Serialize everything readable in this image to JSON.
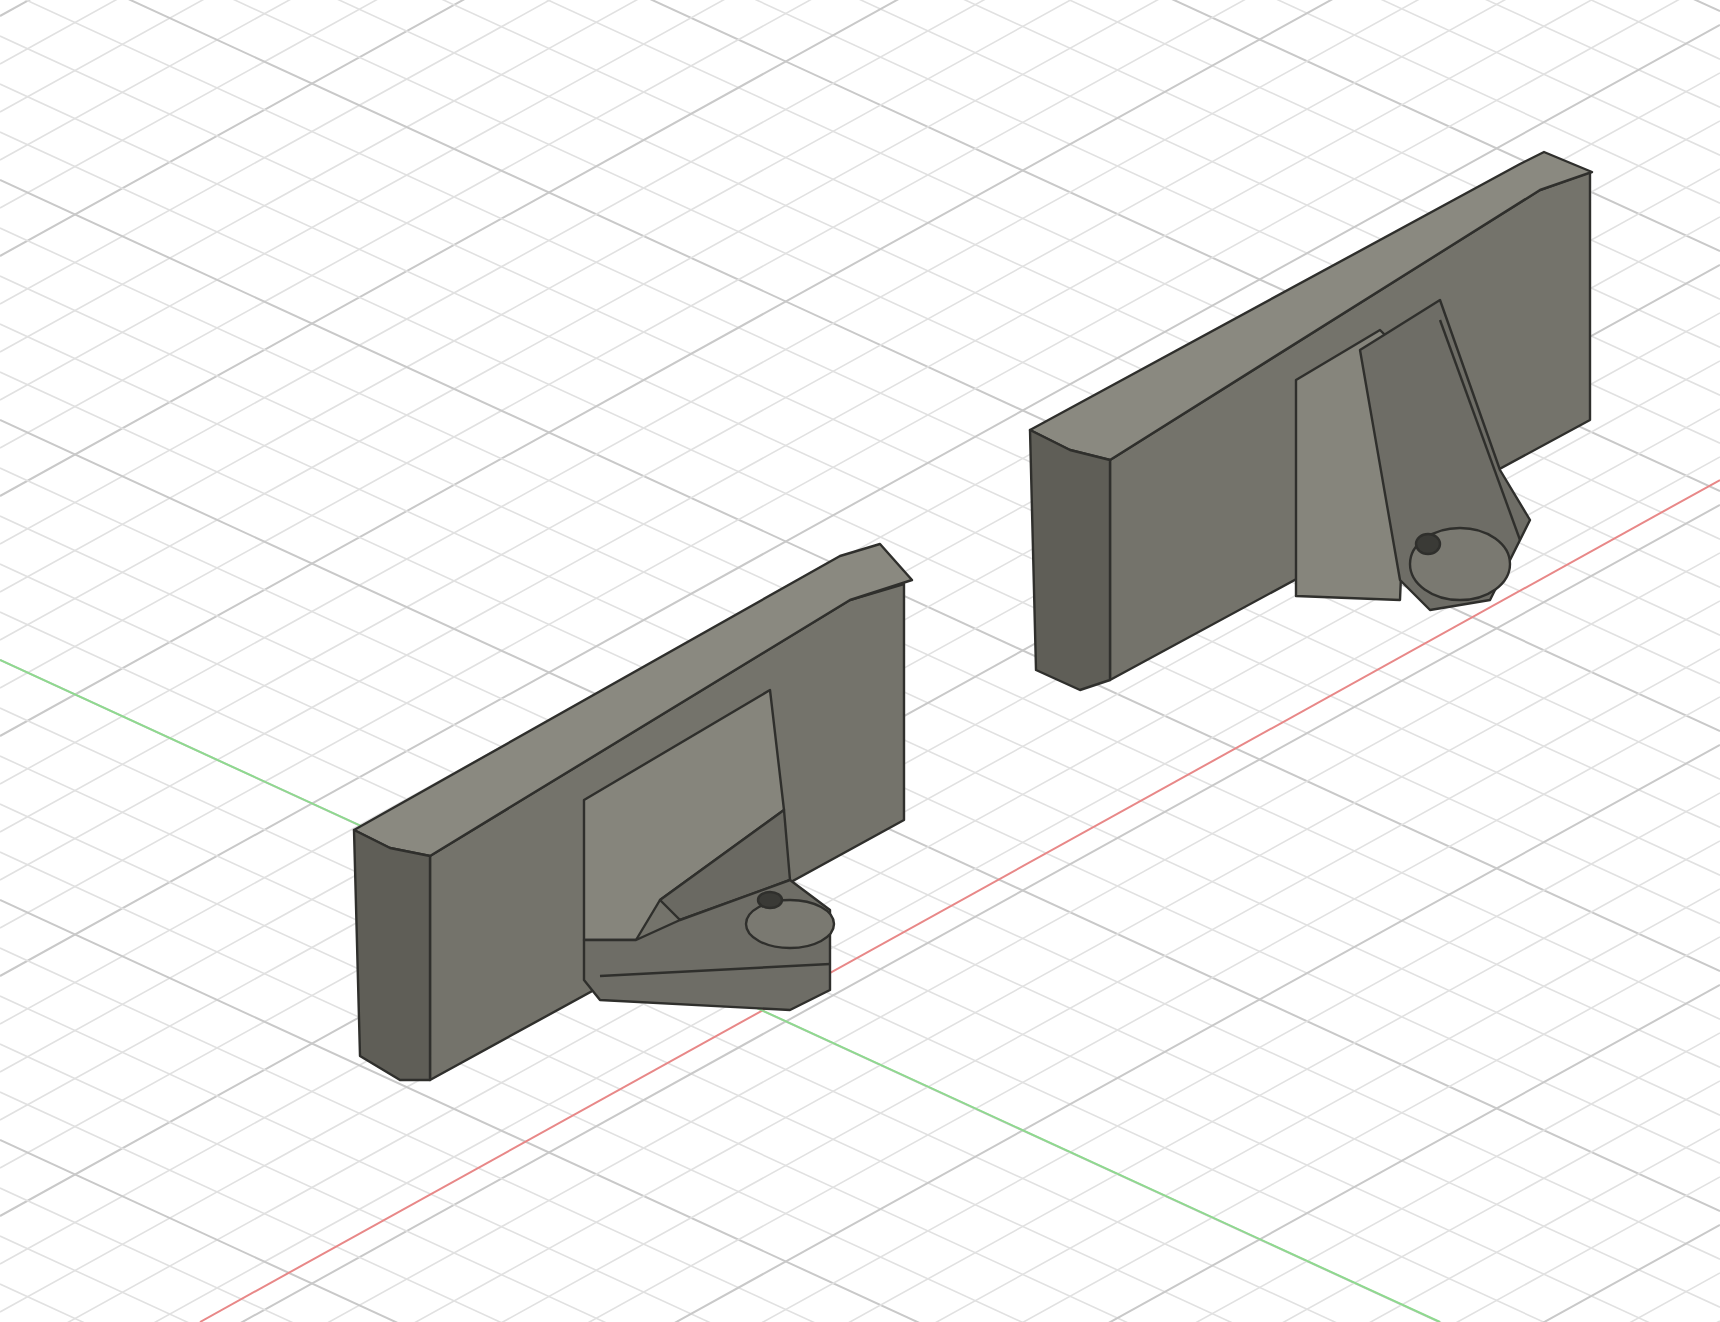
{
  "viewport": {
    "kind": "cad-3d",
    "show_grid": true,
    "show_axes": true
  },
  "parts": [
    {
      "kind": "bracket"
    },
    {
      "kind": "bracket"
    }
  ]
}
